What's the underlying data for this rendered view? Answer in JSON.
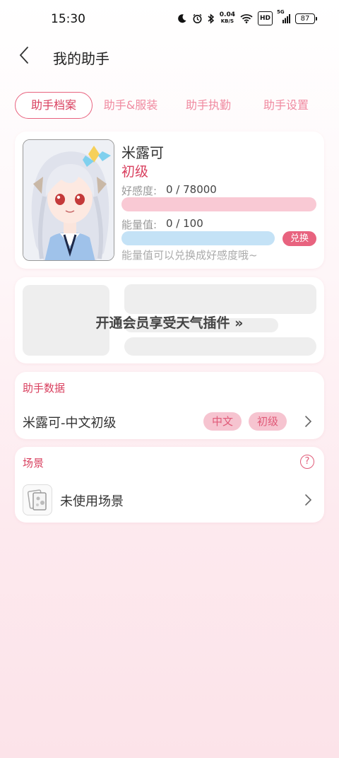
{
  "status_bar": {
    "time": "15:30",
    "net_speed_value": "0.04",
    "net_speed_unit": "KB/S",
    "hd_label": "HD",
    "signal_label": "5G",
    "battery": "87",
    "icons": [
      "moon-icon",
      "alarm-icon",
      "bluetooth-icon",
      "wifi-icon",
      "signal-icon"
    ]
  },
  "header": {
    "title": "我的助手"
  },
  "tabs": [
    {
      "label": "助手档案",
      "active": true
    },
    {
      "label": "助手&服装",
      "active": false
    },
    {
      "label": "助手执勤",
      "active": false
    },
    {
      "label": "助手设置",
      "active": false
    }
  ],
  "profile": {
    "name": "米露可",
    "level": "初级",
    "favor_label": "好感度:",
    "favor_value": "0 / 78000",
    "favor_progress": 0,
    "energy_label": "能量值:",
    "energy_value": "0 / 100",
    "energy_progress": 0,
    "exchange_label": "兑换",
    "note": "能量值可以兑换成好感度哦~"
  },
  "vip": {
    "text": "开通会员享受天气插件 »"
  },
  "assistant_data": {
    "title": "助手数据",
    "row_label": "米露可-中文初级",
    "tags": [
      "中文",
      "初级"
    ]
  },
  "scene": {
    "title": "场景",
    "help": "?",
    "row_label": "未使用场景"
  },
  "colors": {
    "accent": "#e8637f",
    "favor_bar": "#f9c9d4",
    "energy_bar": "#c4e2f6",
    "tag_bg": "#f6c4d0"
  }
}
